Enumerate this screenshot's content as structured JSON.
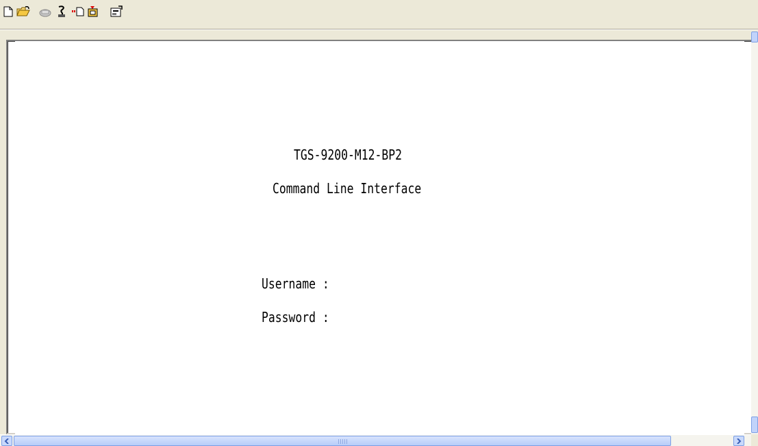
{
  "toolbar": {
    "buttons": [
      {
        "name": "new-icon",
        "tooltip": ""
      },
      {
        "name": "open-folder-icon",
        "tooltip": ""
      },
      {
        "name": "connect-icon",
        "tooltip": ""
      },
      {
        "name": "disconnect-icon",
        "tooltip": ""
      },
      {
        "name": "send-file-icon",
        "tooltip": ""
      },
      {
        "name": "receive-file-icon",
        "tooltip": ""
      },
      {
        "name": "properties-icon",
        "tooltip": ""
      }
    ]
  },
  "terminal": {
    "model": "TGS-9200-M12-BP2",
    "subtitle": "Command Line Interface",
    "username_prompt": "Username :",
    "password_prompt": "Password :",
    "background_color": "#ffffff",
    "text_color": "#000000"
  },
  "colors": {
    "window_bg": "#ece9d8",
    "scrollbar_accent": "#7c9fe5"
  }
}
